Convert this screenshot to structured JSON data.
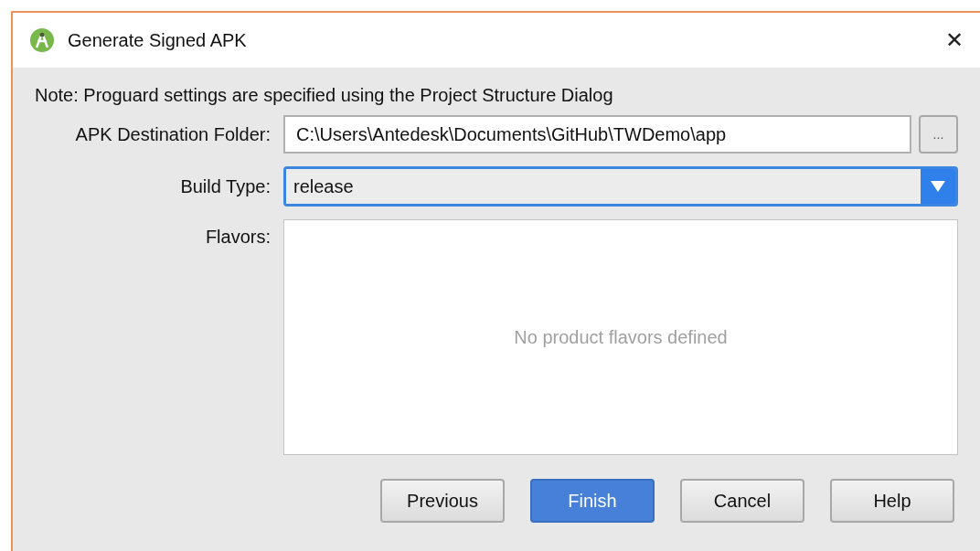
{
  "window": {
    "title": "Generate Signed APK",
    "close": "✕"
  },
  "note": "Note: Proguard settings are specified using the Project Structure Dialog",
  "destination": {
    "label": "APK Destination Folder:",
    "value": "C:\\Users\\Antedesk\\Documents\\GitHub\\TWDemo\\app",
    "browse": "..."
  },
  "build_type": {
    "label": "Build Type:",
    "value": "release",
    "focused": true
  },
  "flavors": {
    "label": "Flavors:",
    "empty_text": "No product flavors defined"
  },
  "buttons": [
    {
      "label": "Previous",
      "default": false
    },
    {
      "label": "Finish",
      "default": true
    },
    {
      "label": "Cancel",
      "default": false
    },
    {
      "label": "Help",
      "default": false
    }
  ]
}
